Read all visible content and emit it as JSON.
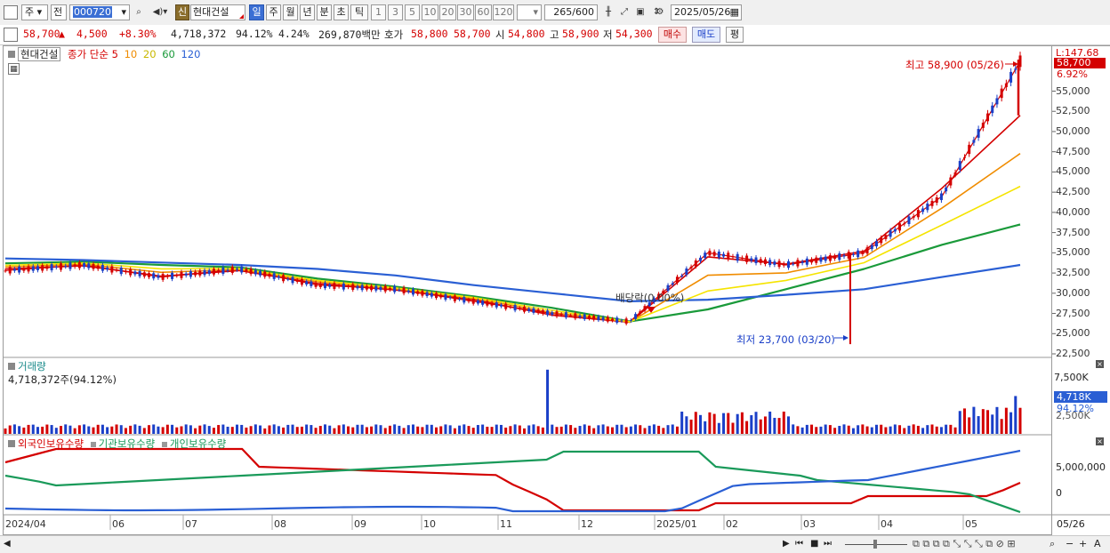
{
  "toolbar": {
    "market": "주",
    "prefix": "전",
    "code": "000720",
    "stock_name_badge": "신",
    "stock_name": "현대건설",
    "periods": [
      "일",
      "주",
      "월",
      "년",
      "분",
      "초",
      "틱"
    ],
    "intervals": [
      "1",
      "3",
      "5",
      "10",
      "20",
      "30",
      "60",
      "120"
    ],
    "count_value": "265",
    "count_total": "/600",
    "date": "2025/05/26"
  },
  "quote": {
    "price": "58,700",
    "change_arrow": "▲",
    "change": "4,500",
    "change_pct": "+8.30%",
    "volume": "4,718,372",
    "volume_pct": "94.12%",
    "turnover_pct": "4.24%",
    "amount": "269,870백만",
    "bid_label": "호가",
    "bid": "58,800",
    "ask": "58,700",
    "open_label": "시",
    "open": "54,800",
    "high_label": "고",
    "high": "58,900",
    "low_label": "저",
    "low": "54,300",
    "buy_button": "매수",
    "sell_button": "매도",
    "eval_button": "평"
  },
  "price_panel": {
    "title": "현대건설",
    "ma_legend": [
      {
        "label": "종가 단순 5",
        "color": "#d40000"
      },
      {
        "label": "10",
        "color": "#f08c00"
      },
      {
        "label": "20",
        "color": "#e8d800"
      },
      {
        "label": "60",
        "color": "#1a9a3a"
      },
      {
        "label": "120",
        "color": "#2a5fd4"
      }
    ],
    "scale_top": "L:147.68",
    "price_tag": "58,700",
    "pct_tag": "6.92%",
    "yticks": [
      "55,000",
      "52,500",
      "50,000",
      "47,500",
      "45,000",
      "42,500",
      "40,000",
      "37,500",
      "35,000",
      "32,500",
      "30,000",
      "27,500",
      "25,000",
      "22,500"
    ],
    "high_annotation": "최고 58,900 (05/26)",
    "low_annotation": "최저 23,700 (03/20)",
    "dividend_annotation": "배당락(0.00%)"
  },
  "volume_panel": {
    "title": "거래량",
    "value": "4,718,372주(94.12%)",
    "yticks": [
      "7,500K",
      "2,500K"
    ],
    "volume_tag": "4,718K",
    "pct_tag": "94.12%"
  },
  "holding_panel": {
    "legend": [
      {
        "label": "외국인보유수량",
        "color": "#d40000"
      },
      {
        "label": "기관보유수량",
        "color": "#1a9a5a"
      },
      {
        "label": "개인보유수량",
        "color": "#2a5fd4"
      }
    ],
    "yticks": [
      "5,000,000",
      "0"
    ]
  },
  "x_axis": {
    "labels": [
      "2024/04",
      "06",
      "07",
      "08",
      "09",
      "10",
      "11",
      "12",
      "2025/01",
      "02",
      "03",
      "04",
      "05"
    ],
    "right_label": "05/26"
  },
  "colors": {
    "up": "#d40000",
    "down": "#1a3fc8",
    "ma5": "#d40000",
    "ma10": "#f08c00",
    "ma20": "#f5e400",
    "ma60": "#1a9a3a",
    "ma120": "#2a5fd4"
  },
  "chart_data": {
    "type": "line",
    "title": "현대건설",
    "price_axis": {
      "ylim": [
        22500,
        58900
      ]
    },
    "dates": [
      "2024/04",
      "06",
      "07",
      "08",
      "09",
      "10",
      "11",
      "12",
      "2025/01",
      "02",
      "03",
      "04",
      "05",
      "05/26"
    ],
    "series": [
      {
        "name": "종가",
        "values": [
          32800,
          33500,
          32000,
          33000,
          31000,
          30500,
          29000,
          27500,
          26500,
          35000,
          33500,
          35000,
          42000,
          58700
        ]
      },
      {
        "name": "5",
        "values": [
          33000,
          33400,
          32100,
          32800,
          31200,
          30400,
          29200,
          27300,
          26400,
          34500,
          33600,
          35200,
          43000,
          52000
        ]
      },
      {
        "name": "60",
        "values": [
          33700,
          33900,
          33500,
          33200,
          31800,
          30800,
          29600,
          28200,
          26500,
          28000,
          30500,
          33000,
          36000,
          38500
        ]
      },
      {
        "name": "120",
        "values": [
          34300,
          34100,
          33800,
          33500,
          33000,
          32200,
          31000,
          30000,
          29000,
          29200,
          29800,
          30500,
          32000,
          33500
        ]
      }
    ],
    "high": {
      "value": 58900,
      "date": "05/26"
    },
    "low": {
      "value": 23700,
      "date": "03/20"
    },
    "volume": {
      "last": 4718372,
      "last_pct": 94.12
    }
  }
}
